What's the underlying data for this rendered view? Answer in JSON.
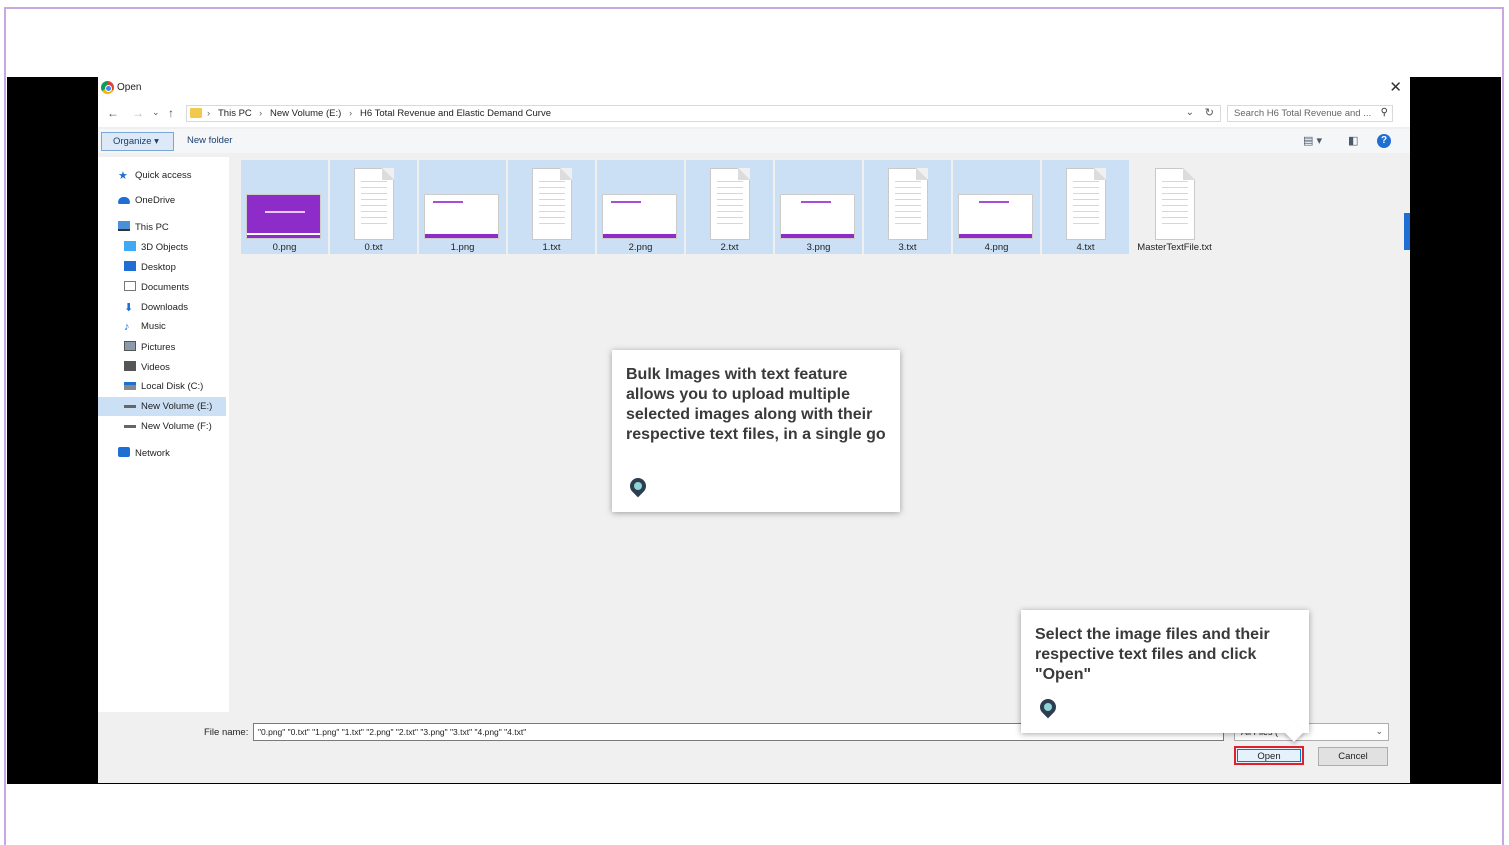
{
  "dialog": {
    "title": "Open",
    "close": "✕"
  },
  "address": {
    "breadcrumbs": [
      "This PC",
      "New Volume (E:)",
      "H6 Total Revenue and Elastic Demand Curve"
    ],
    "separator": "›",
    "search_placeholder": "Search H6 Total Revenue and ..."
  },
  "toolbar": {
    "organize_label": "Organize ▾",
    "new_folder_label": "New folder"
  },
  "sidebar": {
    "items": [
      {
        "label": "Quick access",
        "icon": "star-icon",
        "color": "#1f6ed4"
      },
      {
        "label": "OneDrive",
        "icon": "cloud-icon",
        "color": "#1f6ed4"
      },
      {
        "label": "This PC",
        "icon": "computer-icon",
        "color": "#4a90d9"
      },
      {
        "label": "3D Objects",
        "icon": "cube-icon",
        "color": "#3fa9f5"
      },
      {
        "label": "Desktop",
        "icon": "desktop-icon",
        "color": "#1f6ed4"
      },
      {
        "label": "Documents",
        "icon": "document-icon",
        "color": "#777777"
      },
      {
        "label": "Downloads",
        "icon": "download-icon",
        "color": "#1f6ed4"
      },
      {
        "label": "Music",
        "icon": "music-icon",
        "color": "#1f6ed4"
      },
      {
        "label": "Pictures",
        "icon": "pictures-icon",
        "color": "#555555"
      },
      {
        "label": "Videos",
        "icon": "video-icon",
        "color": "#555555"
      },
      {
        "label": "Local Disk (C:)",
        "icon": "drive-icon",
        "color": "#555555"
      },
      {
        "label": "New Volume (E:)",
        "icon": "drive-icon",
        "color": "#555555"
      },
      {
        "label": "New Volume (F:)",
        "icon": "drive-icon",
        "color": "#555555"
      },
      {
        "label": "Network",
        "icon": "network-icon",
        "color": "#1f6ed4"
      }
    ],
    "selected_index": 11
  },
  "files": [
    {
      "name": "0.png",
      "kind": "image-purple",
      "selected": true
    },
    {
      "name": "0.txt",
      "kind": "text",
      "selected": true
    },
    {
      "name": "1.png",
      "kind": "image",
      "selected": true
    },
    {
      "name": "1.txt",
      "kind": "text",
      "selected": true
    },
    {
      "name": "2.png",
      "kind": "image",
      "selected": true
    },
    {
      "name": "2.txt",
      "kind": "text",
      "selected": true
    },
    {
      "name": "3.png",
      "kind": "image",
      "selected": true
    },
    {
      "name": "3.txt",
      "kind": "text",
      "selected": true
    },
    {
      "name": "4.png",
      "kind": "image",
      "selected": true
    },
    {
      "name": "4.txt",
      "kind": "text",
      "selected": true
    },
    {
      "name": "MasterTextFile.txt",
      "kind": "text",
      "selected": false
    }
  ],
  "bottom": {
    "file_name_label": "File name:",
    "file_name_value": "\"0.png\" \"0.txt\" \"1.png\" \"1.txt\" \"2.png\" \"2.txt\" \"3.png\" \"3.txt\" \"4.png\" \"4.txt\"",
    "file_type_value": "All Files (*",
    "open_label": "Open",
    "cancel_label": "Cancel"
  },
  "callouts": {
    "bulk_text": "Bulk Images with text feature allows you to upload multiple selected images along with their respective text files, in a single go",
    "select_text": "Select the image files and their respective text files and click \"Open\""
  },
  "colors": {
    "selection": "#cce0f5",
    "accent_purple": "#8e2cc9",
    "highlight_red": "#e0202a",
    "frame_border": "#c8a8e0"
  }
}
